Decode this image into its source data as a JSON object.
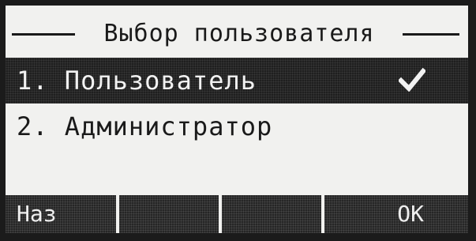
{
  "screen": {
    "title": "Выбор пользователя"
  },
  "menu": {
    "items": [
      {
        "label": "1. Пользователь",
        "selected": true,
        "checked": true
      },
      {
        "label": "2. Администратор",
        "selected": false,
        "checked": false
      }
    ]
  },
  "softkeys": [
    {
      "label": "Наз"
    },
    {
      "label": ""
    },
    {
      "label": ""
    },
    {
      "label": "OK"
    }
  ],
  "colors": {
    "screen_bg": "#f1f1ef",
    "ink": "#1a1a1a",
    "highlight": "#1f1f1f"
  },
  "icons": {
    "selected_marker": "checkmark-icon"
  }
}
